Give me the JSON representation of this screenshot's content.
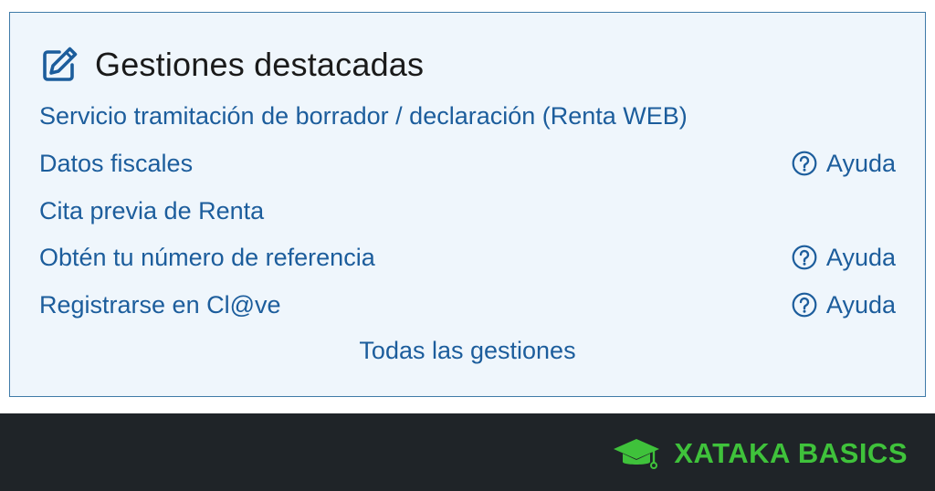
{
  "panel": {
    "title": "Gestiones destacadas",
    "title_icon": "edit-icon",
    "items": [
      {
        "label": "Servicio tramitación de borrador / declaración (Renta WEB)",
        "help": ""
      },
      {
        "label": "Datos fiscales",
        "help": "Ayuda"
      },
      {
        "label": "Cita previa de Renta",
        "help": ""
      },
      {
        "label": "Obtén tu número de referencia",
        "help": "Ayuda"
      },
      {
        "label": "Registrarse en Cl@ve",
        "help": "Ayuda"
      }
    ],
    "all_link": "Todas las gestiones"
  },
  "footer": {
    "brand": "XATAKA BASICS",
    "brand_icon": "graduation-cap-icon"
  },
  "colors": {
    "link": "#1c5d9c",
    "panel_border": "#3f7ba8",
    "panel_bg": "#eff6fc",
    "footer_bg": "#1f2428",
    "brand": "#3fc23b"
  }
}
